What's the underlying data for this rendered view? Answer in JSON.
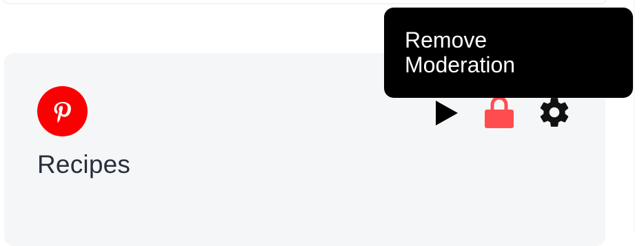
{
  "card": {
    "title": "Recipes",
    "brand_icon": "pinterest-icon",
    "brand_color": "#fb0000"
  },
  "actions": {
    "play_icon": "play-icon",
    "lock_icon": "lock-icon",
    "lock_color": "#ff4d4f",
    "settings_icon": "gear-icon"
  },
  "tooltip": {
    "line1": "Remove",
    "line2": "Moderation"
  }
}
